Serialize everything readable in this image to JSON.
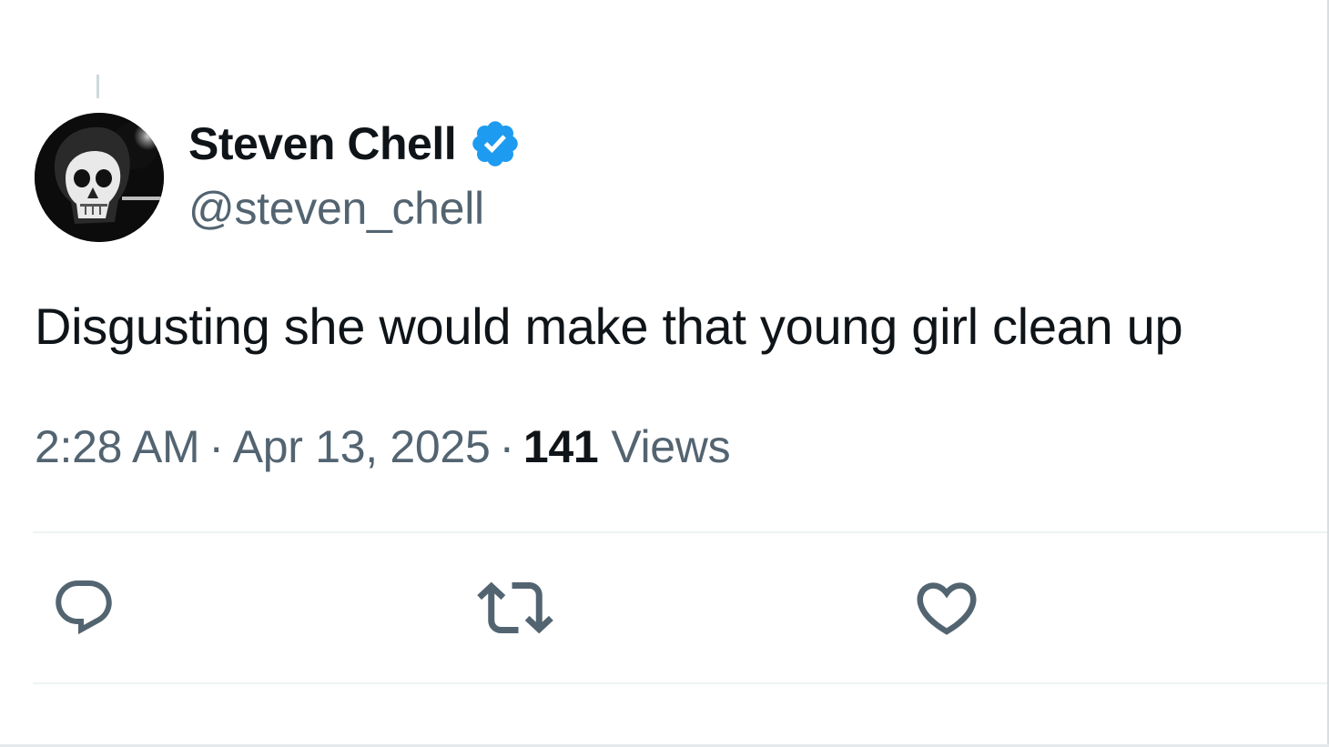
{
  "tweet": {
    "author": {
      "display_name": "Steven Chell",
      "handle": "@steven_chell",
      "verified": true,
      "verified_color": "#1d9bf0",
      "avatar_icon": "skull-avatar"
    },
    "text": "Disgusting she would make that young girl clean up",
    "time": "2:28 AM",
    "date": "Apr 13, 2025",
    "separator": "·",
    "views_count": "141",
    "views_label": "Views"
  },
  "actions": [
    {
      "name": "reply",
      "icon": "reply-icon"
    },
    {
      "name": "repost",
      "icon": "repost-icon"
    },
    {
      "name": "like",
      "icon": "heart-icon"
    }
  ],
  "colors": {
    "text_primary": "#0f1419",
    "text_secondary": "#536471",
    "icon": "#536471",
    "divider": "#eff3f4"
  }
}
